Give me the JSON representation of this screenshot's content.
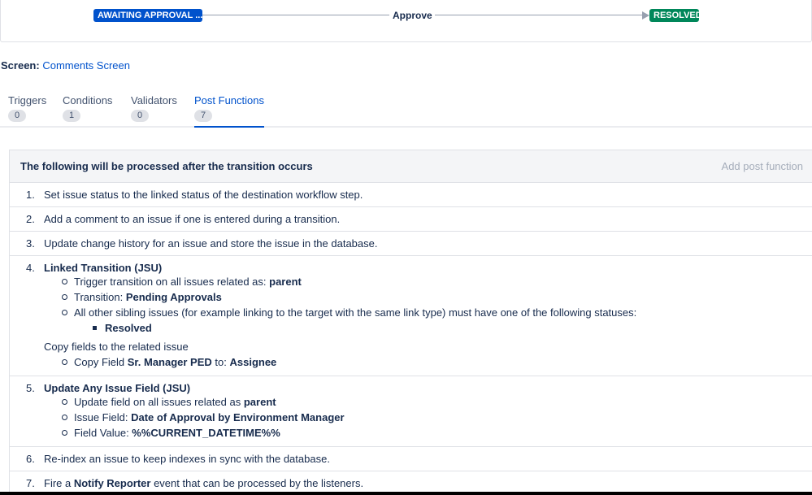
{
  "workflow": {
    "from_status": "AWAITING APPROVAL ...",
    "transition": "Approve",
    "to_status": "RESOLVED",
    "colors": {
      "from": "#0052cc",
      "to": "#00875a"
    }
  },
  "screen": {
    "label": "Screen:",
    "value": "Comments Screen"
  },
  "tabs": [
    {
      "label": "Triggers",
      "count": "0"
    },
    {
      "label": "Conditions",
      "count": "1"
    },
    {
      "label": "Validators",
      "count": "0"
    },
    {
      "label": "Post Functions",
      "count": "7",
      "active": true
    }
  ],
  "post_functions": {
    "header": "The following will be processed after the transition occurs",
    "add_label": "Add post function",
    "items": [
      {
        "num": "1.",
        "text": "Set issue status to the linked status of the destination workflow step."
      },
      {
        "num": "2.",
        "text": "Add a comment to an issue if one is entered during a transition."
      },
      {
        "num": "3.",
        "text": "Update change history for an issue and store the issue in the database."
      },
      {
        "num": "4.",
        "title": "Linked Transition (JSU)",
        "b1_pre": "Trigger transition on all issues related as: ",
        "b1_val": "parent",
        "b2_pre": "Transition: ",
        "b2_val": "Pending Approvals",
        "b3": "All other sibling issues (for example linking to the target with the same link type) must have one of the following statuses:",
        "b3_sub": "Resolved",
        "copy_text": "Copy fields to the related issue",
        "copy_pre": "Copy Field ",
        "copy_field": "Sr. Manager PED",
        "copy_mid": " to: ",
        "copy_target": "Assignee"
      },
      {
        "num": "5.",
        "title": "Update Any Issue Field (JSU)",
        "b1_pre": "Update field on all issues related as ",
        "b1_val": "parent",
        "b2_pre": "Issue Field: ",
        "b2_val": "Date of Approval by Environment Manager",
        "b3_pre": "Field Value: ",
        "b3_val": "%%CURRENT_DATETIME%%"
      },
      {
        "num": "6.",
        "text": "Re-index an issue to keep indexes in sync with the database."
      },
      {
        "num": "7.",
        "pre": "Fire a ",
        "event": "Notify Reporter",
        "post": " event that can be processed by the listeners."
      }
    ]
  }
}
